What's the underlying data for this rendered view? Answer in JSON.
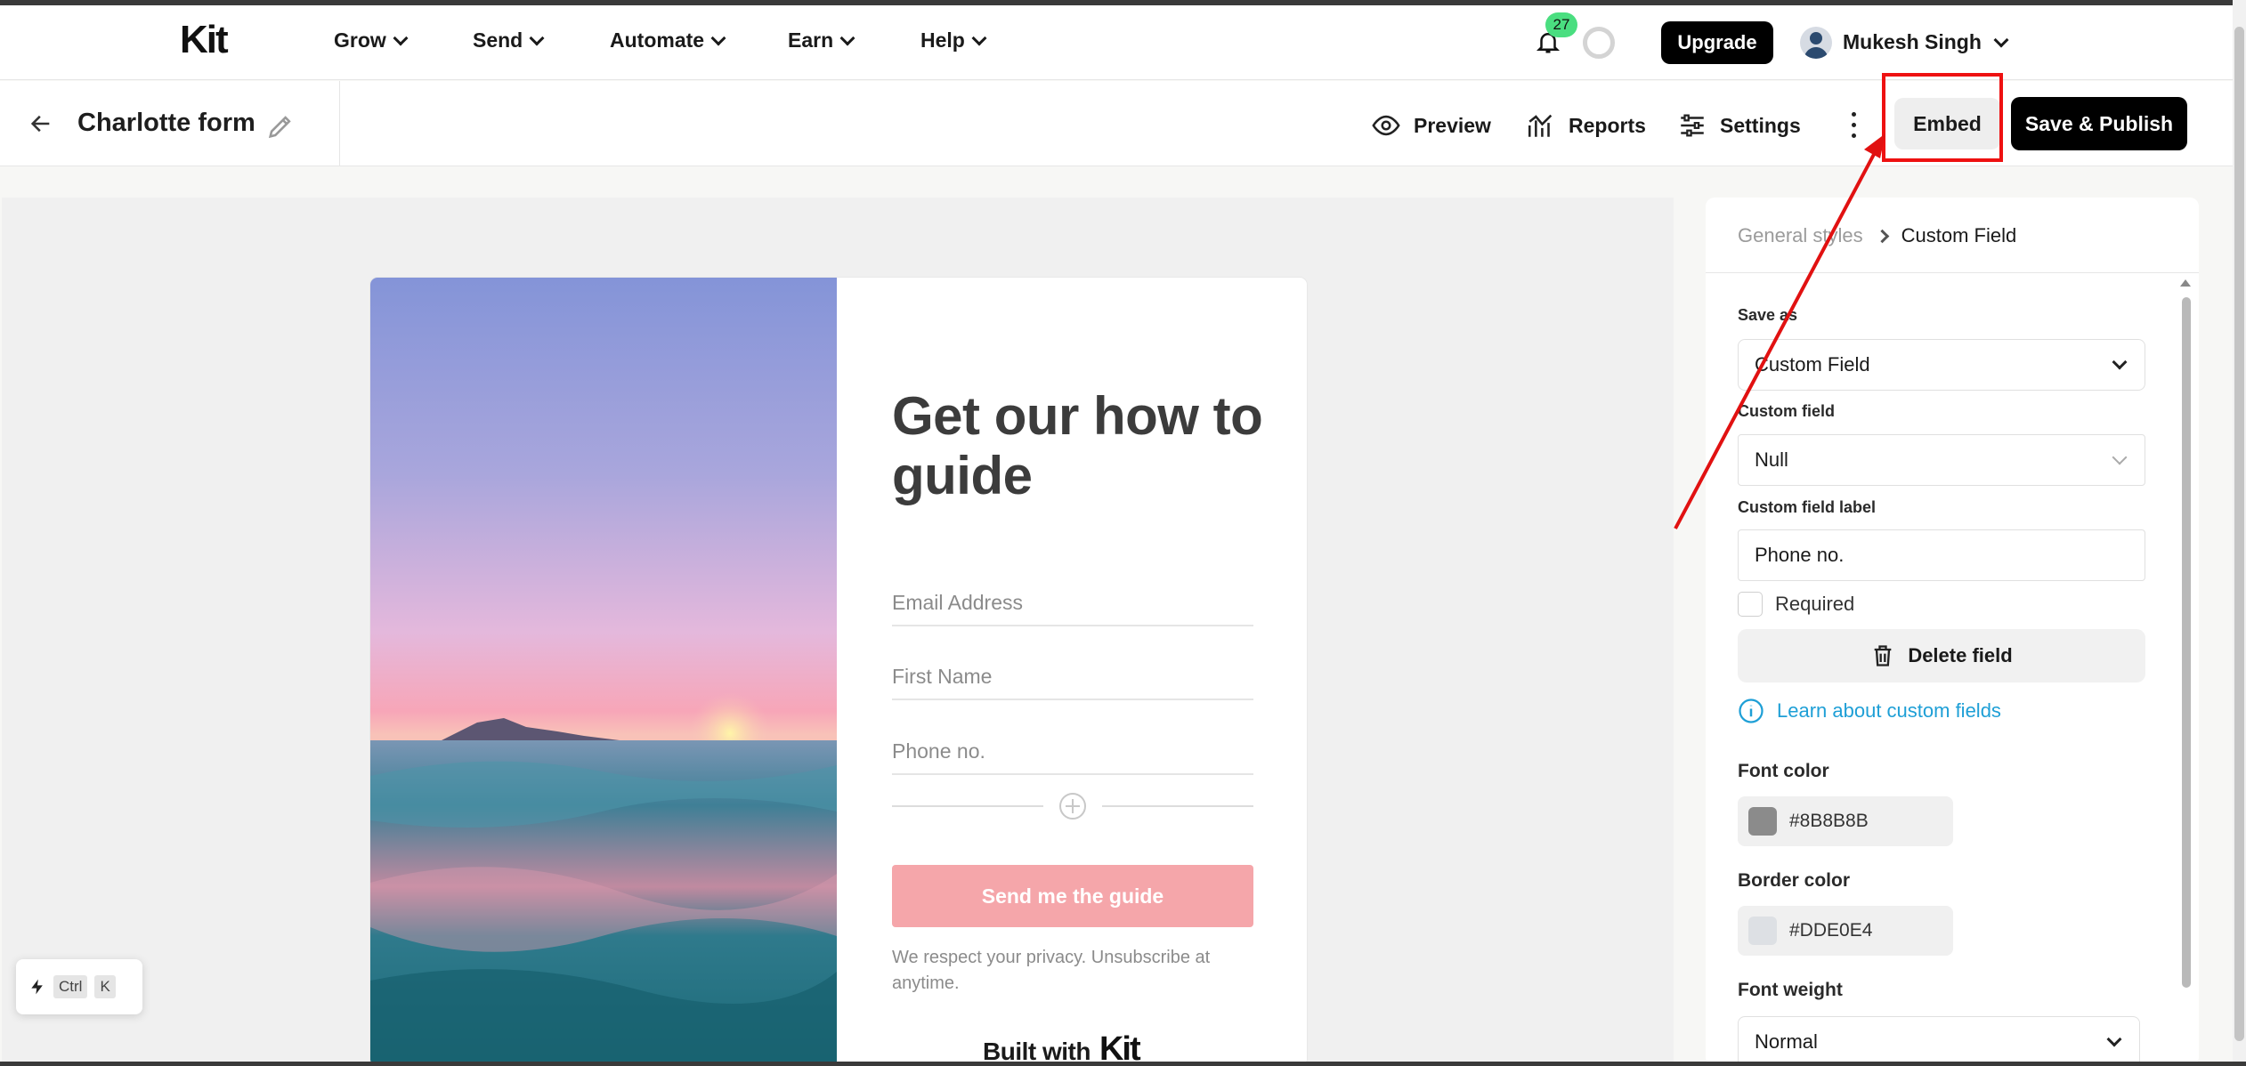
{
  "topnav": {
    "logo": "Kit",
    "items": [
      {
        "label": "Grow"
      },
      {
        "label": "Send"
      },
      {
        "label": "Automate"
      },
      {
        "label": "Earn"
      },
      {
        "label": "Help"
      }
    ],
    "notification_count": "27",
    "upgrade_label": "Upgrade",
    "user_name": "Mukesh Singh"
  },
  "toolbar": {
    "form_title": "Charlotte form",
    "preview_label": "Preview",
    "reports_label": "Reports",
    "settings_label": "Settings",
    "embed_label": "Embed",
    "save_publish_label": "Save & Publish"
  },
  "form": {
    "headline": "Get our how to guide",
    "fields": [
      {
        "placeholder": "Email Address"
      },
      {
        "placeholder": "First Name"
      },
      {
        "placeholder": "Phone no."
      }
    ],
    "button_label": "Send me the guide",
    "privacy_text": "We respect your privacy. Unsubscribe at anytime.",
    "built_with": "Built with",
    "built_with_logo": "Kit"
  },
  "shortcut": {
    "key1": "Ctrl",
    "key2": "K"
  },
  "panel": {
    "breadcrumb_parent": "General styles",
    "breadcrumb_current": "Custom Field",
    "save_as_label": "Save as",
    "save_as_value": "Custom Field",
    "custom_field_label": "Custom field",
    "custom_field_value": "Null",
    "custom_field_label_label": "Custom field label",
    "custom_field_label_value": "Phone no.",
    "required_label": "Required",
    "delete_label": "Delete field",
    "learn_link": "Learn about custom fields",
    "font_color_label": "Font color",
    "font_color_value": "#8B8B8B",
    "border_color_label": "Border color",
    "border_color_value": "#DDE0E4",
    "font_weight_label": "Font weight",
    "font_weight_value": "Normal"
  },
  "colors": {
    "button_pink": "#f5a6aa",
    "link_blue": "#1e9fd6",
    "badge_green": "#4ade80",
    "annotation_red": "#e11111"
  }
}
